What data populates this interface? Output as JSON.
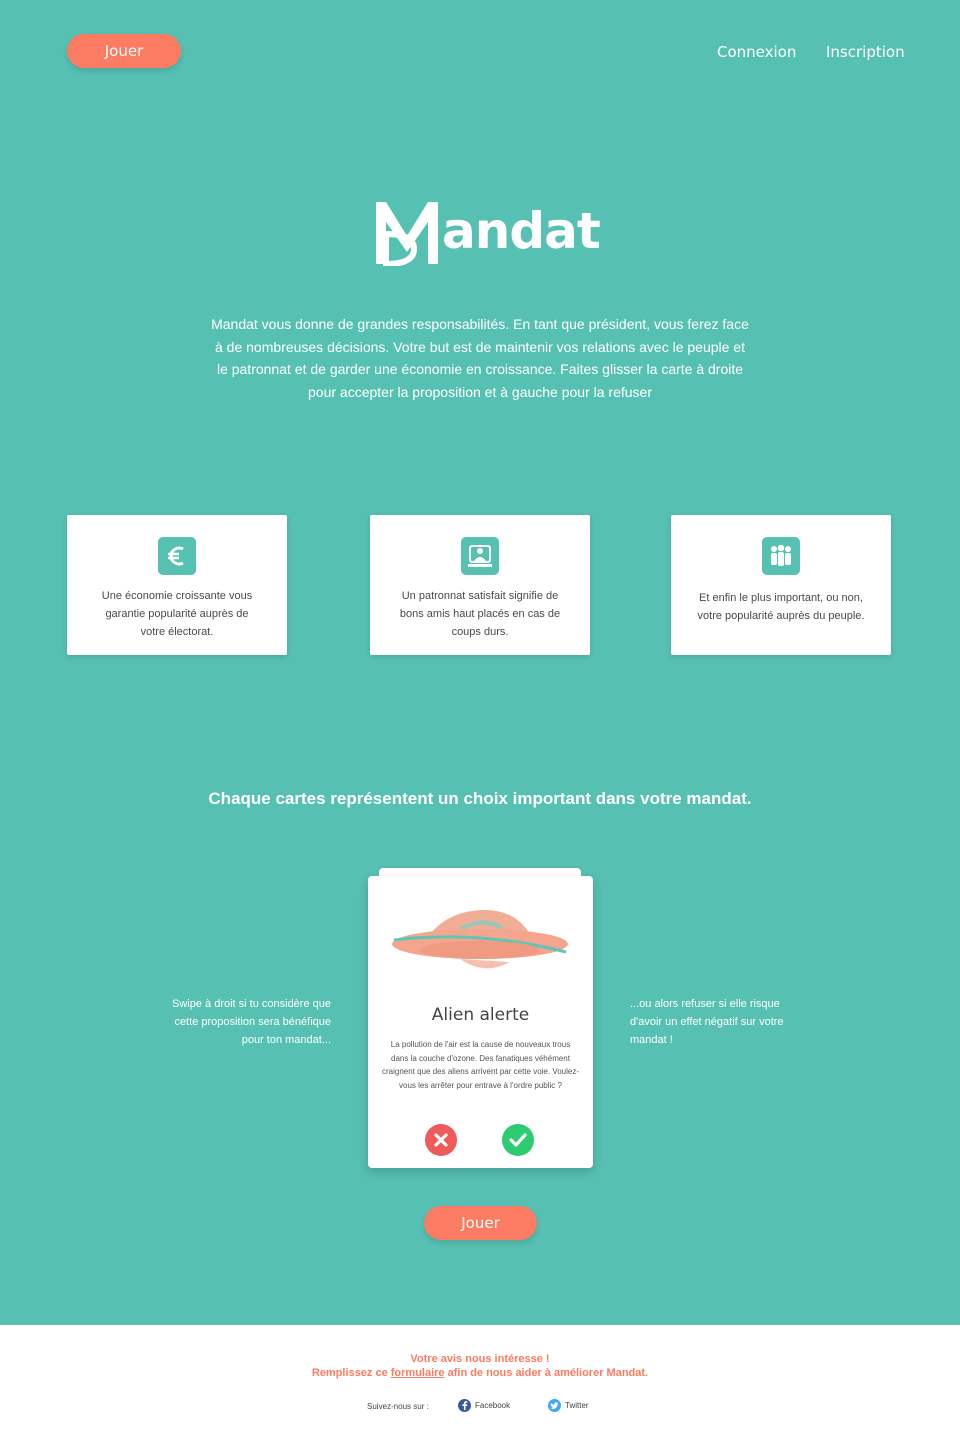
{
  "header": {
    "play_label": "Jouer",
    "login_label": "Connexion",
    "signup_label": "Inscription"
  },
  "logo": {
    "text": "andat"
  },
  "intro": "Mandat vous donne de grandes responsabilités. En tant que président, vous ferez face à de nombreuses décisions. Votre but est de maintenir vos relations avec le peuple et le patronnat et de garder une économie en croissance. Faites glisser la carte à droite pour accepter la proposition et à gauche pour la refuser",
  "features": [
    {
      "icon": "euro-icon",
      "text": "Une économie croissante vous garantie popularité auprès de votre électorat."
    },
    {
      "icon": "boss-icon",
      "text": "Un patronnat satisfait signifie de bons amis haut placés en cas de coups durs."
    },
    {
      "icon": "people-icon",
      "text": "Et enfin le plus important, ou non, votre popularité auprès du peuple."
    }
  ],
  "subtitle": "Chaque cartes représentent un choix important dans votre mandat.",
  "demo": {
    "left_text": "Swipe à droit si tu considère que cette proposition sera bénéfique pour ton mandat...",
    "right_text": "...ou alors refuser si elle risque d'avoir un effet négatif sur votre mandat !",
    "card": {
      "image": "ufo-illustration",
      "title": "Alien alerte",
      "text": "La pollution de l'air est la cause de nouveaux trous dans la couche d'ozone. Des fanatiques véhément craignent que des aliens arrivent par cette voie. Voulez-vous les arrêter pour entrave à l'ordre public ?"
    },
    "play_label": "Jouer"
  },
  "footer": {
    "line1": "Votre avis nous intéresse !",
    "line2_before": "Remplissez ce ",
    "line2_link": "formulaire",
    "line2_after": " afin de nous aider à améliorer Mandat.",
    "follow_label": "Suivez-nous sur :",
    "facebook_label": "Facebook",
    "twitter_label": "Twitter"
  },
  "colors": {
    "primary": "#56c0b2",
    "accent": "#fb7b63",
    "reject": "#f05a5a",
    "accept": "#2ecc71"
  }
}
